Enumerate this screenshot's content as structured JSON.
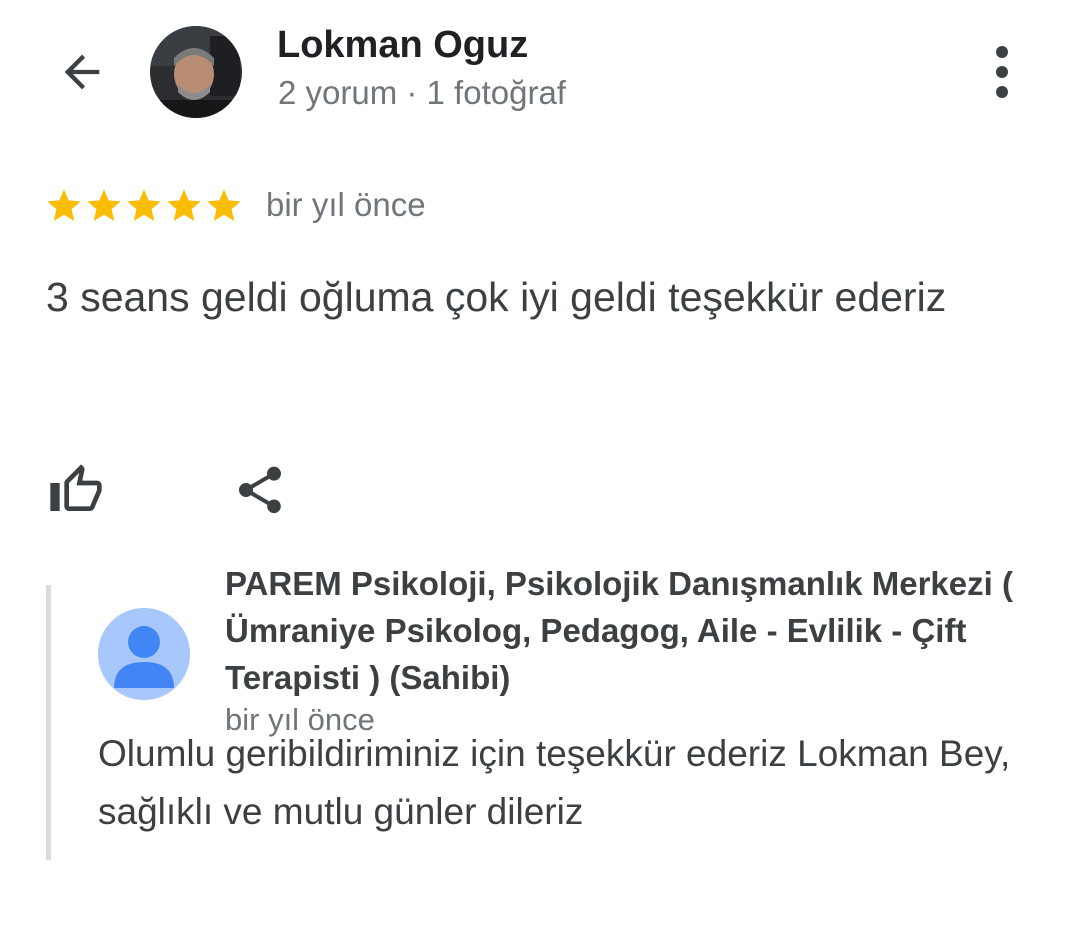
{
  "header": {
    "user_name": "Lokman Oguz",
    "user_meta": "2 yorum · 1 fotoğraf"
  },
  "review": {
    "rating": 5,
    "rating_max": 5,
    "date": "bir yıl önce",
    "text": "3 seans geldi oğluma çok iyi geldi teşekkür ederiz"
  },
  "actions": {
    "like_icon": "thumb-up-icon",
    "share_icon": "share-icon"
  },
  "owner_reply": {
    "name": "PAREM Psikoloji, Psikolojik Danışmanlık Merkezi ( Ümraniye Psikolog, Pedagog, Aile - Evlilik - Çift Terapisti ) (Sahibi)",
    "date": "bir yıl önce",
    "text": "Olumlu geribildiriminiz için teşekkür ederiz Lokman Bey, sağlıklı ve mutlu günler dileriz"
  },
  "colors": {
    "star": "#fbbc04",
    "text_primary": "#202124",
    "text_secondary": "#70757a",
    "owner_avatar_bg": "#a8c7fa",
    "owner_avatar_fg": "#4285f4"
  }
}
